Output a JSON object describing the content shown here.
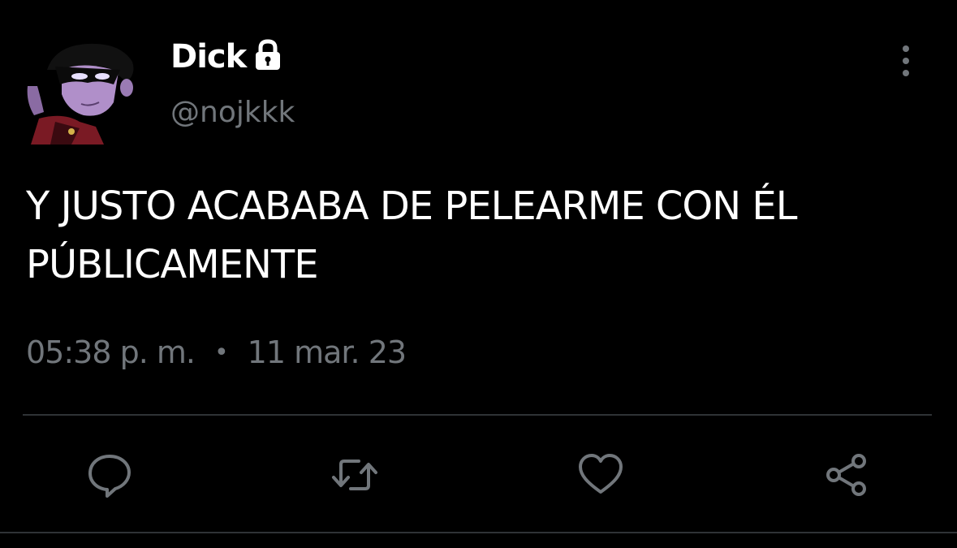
{
  "user": {
    "display_name": "Dick",
    "handle": "@nojkkk",
    "avatar_icon": "avatar-image",
    "protected_icon": "lock-icon"
  },
  "tweet": {
    "text": "Y JUSTO ACABABA DE PELEARME CON ÉL\nPÚBLICAMENTE",
    "time": "05:38 p. m.",
    "separator": "•",
    "date": "11 mar. 23"
  },
  "actions": {
    "reply_icon": "reply-icon",
    "retweet_icon": "retweet-icon",
    "like_icon": "heart-icon",
    "share_icon": "share-icon",
    "more_icon": "more-vertical-icon"
  },
  "colors": {
    "background": "#000000",
    "text": "#ffffff",
    "secondary": "#71767b",
    "divider": "#2f3336"
  }
}
